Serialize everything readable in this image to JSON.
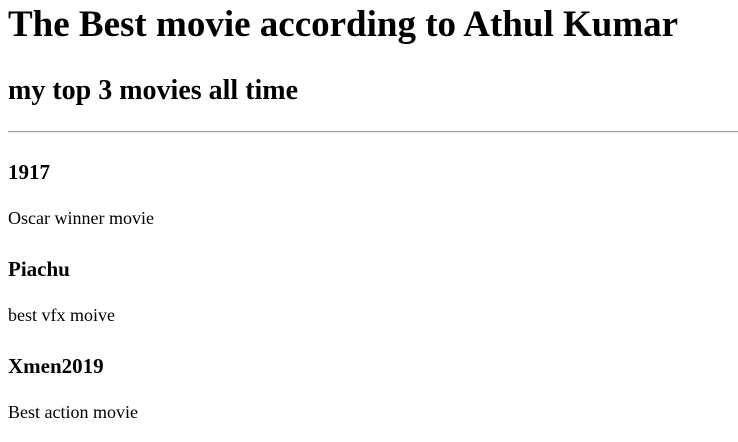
{
  "page": {
    "heading": "The Best movie according to Athul Kumar",
    "subheading": "my top 3 movies all time"
  },
  "movies": [
    {
      "title": "1917",
      "description": "Oscar winner movie"
    },
    {
      "title": "Piachu",
      "description": "best vfx moive"
    },
    {
      "title": "Xmen2019",
      "description": "Best action movie"
    }
  ]
}
